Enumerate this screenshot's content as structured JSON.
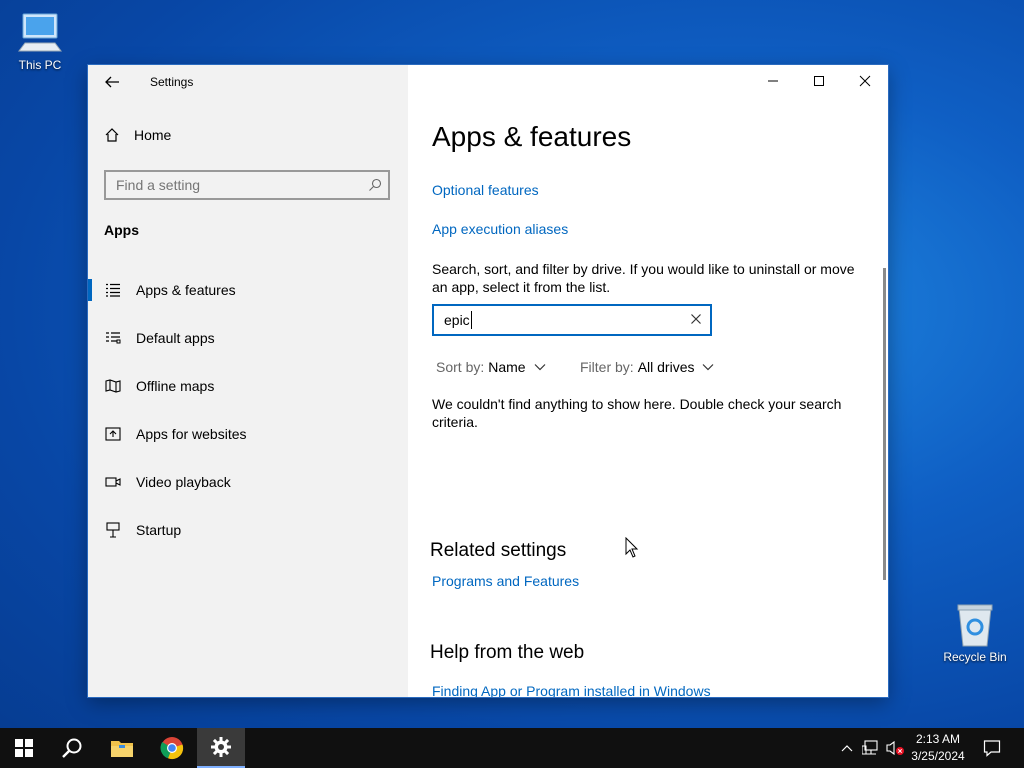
{
  "desktop": {
    "icons": [
      {
        "label": "This PC",
        "icon": "computer-icon"
      },
      {
        "label": "Recycle Bin",
        "icon": "recycle-bin-icon"
      }
    ]
  },
  "window": {
    "title": "Settings",
    "controls": [
      "minimize-icon",
      "maximize-icon",
      "close-icon"
    ]
  },
  "sidebar": {
    "home_label": "Home",
    "search_placeholder": "Find a setting",
    "section_title": "Apps",
    "items": [
      {
        "label": "Apps & features",
        "icon": "list-icon",
        "selected": true
      },
      {
        "label": "Default apps",
        "icon": "default-apps-icon",
        "selected": false
      },
      {
        "label": "Offline maps",
        "icon": "map-icon",
        "selected": false
      },
      {
        "label": "Apps for websites",
        "icon": "web-app-icon",
        "selected": false
      },
      {
        "label": "Video playback",
        "icon": "video-icon",
        "selected": false
      },
      {
        "label": "Startup",
        "icon": "startup-icon",
        "selected": false
      }
    ]
  },
  "main": {
    "title": "Apps & features",
    "links": {
      "optional_features": "Optional features",
      "app_execution_aliases": "App execution aliases"
    },
    "description": "Search, sort, and filter by drive. If you would like to uninstall or move an app, select it from the list.",
    "search_value": "epic",
    "sort_label": "Sort by:",
    "sort_value": "Name",
    "filter_label": "Filter by:",
    "filter_value": "All drives",
    "empty_message": "We couldn't find anything to show here. Double check your search criteria.",
    "related_settings": {
      "title": "Related settings",
      "link": "Programs and Features"
    },
    "help": {
      "title": "Help from the web",
      "link": "Finding App or Program installed in Windows"
    }
  },
  "taskbar": {
    "apps": [
      "start-icon",
      "search-icon",
      "file-explorer-icon",
      "chrome-icon",
      "settings-icon"
    ],
    "clock_time": "2:13 AM",
    "clock_date": "3/25/2024"
  },
  "colors": {
    "accent": "#0067c0",
    "sidebar_bg": "#f2f2f2",
    "taskbar_bg": "#101010"
  }
}
